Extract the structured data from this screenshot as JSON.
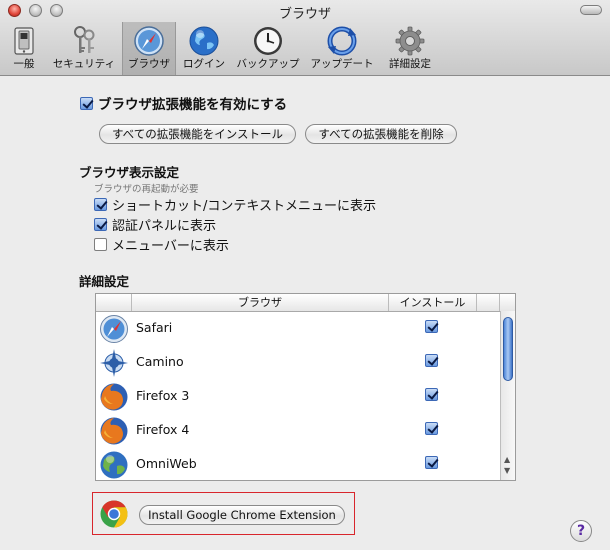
{
  "window": {
    "title": "ブラウザ"
  },
  "toolbar": {
    "items": [
      {
        "label": "一般",
        "icon": "switch-icon",
        "selected": false
      },
      {
        "label": "セキュリティ",
        "icon": "keys-icon",
        "selected": false
      },
      {
        "label": "ブラウザ",
        "icon": "safari-compass-icon",
        "selected": true
      },
      {
        "label": "ログイン",
        "icon": "globe-icon",
        "selected": false
      },
      {
        "label": "バックアップ",
        "icon": "clock-icon",
        "selected": false
      },
      {
        "label": "アップデート",
        "icon": "update-arrows-icon",
        "selected": false
      },
      {
        "label": "詳細設定",
        "icon": "gear-icon",
        "selected": false
      }
    ]
  },
  "extensions": {
    "enable_label": "ブラウザ拡張機能を有効にする",
    "enabled": true,
    "install_all_label": "すべての拡張機能をインストール",
    "remove_all_label": "すべての拡張機能を削除"
  },
  "display": {
    "heading": "ブラウザ表示設定",
    "note": "ブラウザの再起動が必要",
    "options": [
      {
        "label": "ショートカット/コンテキストメニューに表示",
        "checked": true
      },
      {
        "label": "認証パネルに表示",
        "checked": true
      },
      {
        "label": "メニューバーに表示",
        "checked": false
      }
    ]
  },
  "advanced": {
    "heading": "詳細設定",
    "columns": [
      "ブラウザ",
      "インストール"
    ],
    "rows": [
      {
        "name": "Safari",
        "icon": "safari-icon",
        "installed": true
      },
      {
        "name": "Camino",
        "icon": "camino-icon",
        "installed": true
      },
      {
        "name": "Firefox 3",
        "icon": "firefox-icon",
        "installed": true
      },
      {
        "name": "Firefox 4",
        "icon": "firefox-icon",
        "installed": true
      },
      {
        "name": "OmniWeb",
        "icon": "omniweb-icon",
        "installed": true
      }
    ]
  },
  "chrome": {
    "button_label": "Install Google Chrome Extension",
    "icon": "chrome-icon"
  },
  "help": {
    "label": "?"
  },
  "colors": {
    "highlight": "#d8262c",
    "accent": "#3c68b6"
  }
}
